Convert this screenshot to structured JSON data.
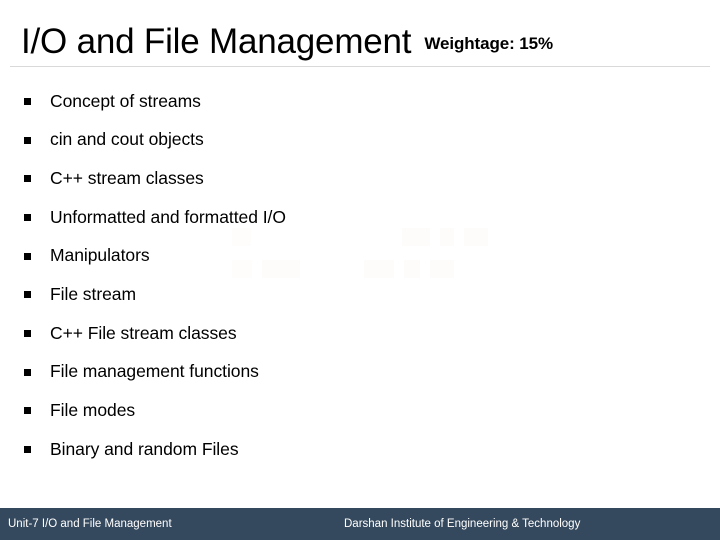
{
  "slide": {
    "title": "I/O and File Management",
    "weightage": "Weightage: 15%",
    "bullets": [
      {
        "text": "Concept of streams"
      },
      {
        "text": "cin and cout objects"
      },
      {
        "text": "C++ stream classes"
      },
      {
        "text": "Unformatted and formatted I/O"
      },
      {
        "text": "Manipulators"
      },
      {
        "text": "File stream"
      },
      {
        "text": "C++ File stream classes"
      },
      {
        "text": "File management functions"
      },
      {
        "text": "File modes"
      },
      {
        "text": "Binary and random Files"
      }
    ]
  },
  "footer": {
    "left": "Unit-7 I/O and File Management",
    "right": "Darshan Institute of Engineering & Technology",
    "background_color": "#35495e",
    "text_color": "#ffffff"
  },
  "colors": {
    "title_text": "#000000",
    "body_text": "#000000",
    "rule": "#d9d9d9",
    "page_background": "#ffffff"
  }
}
